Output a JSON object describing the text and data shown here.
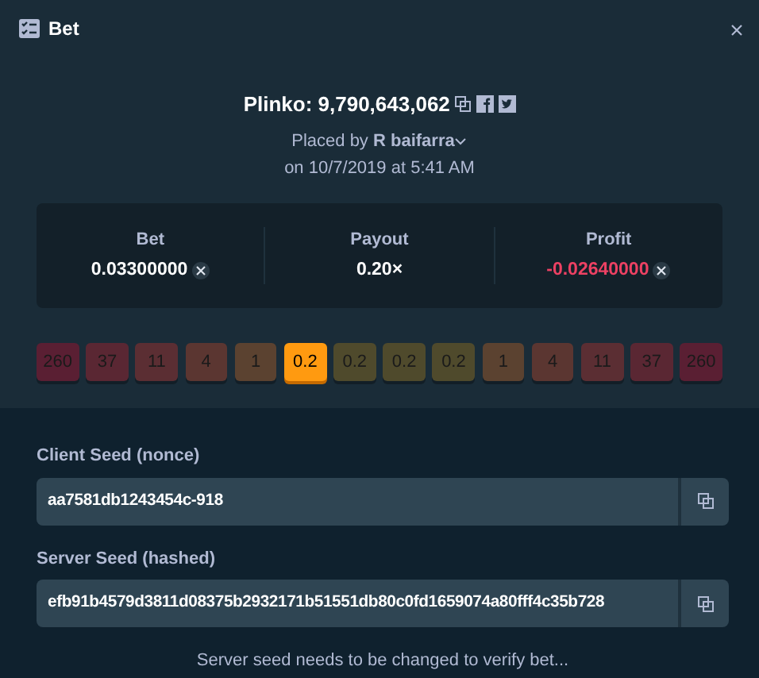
{
  "window": {
    "title": "Bet"
  },
  "bet_title": "Plinko: 9,790,643,062",
  "placed_by": {
    "prefix": "Placed by",
    "user": "R baifarra",
    "date": "on 10/7/2019 at 5:41 AM"
  },
  "stats": [
    {
      "label": "Bet",
      "value": "0.03300000",
      "kind": "currency",
      "negative": false
    },
    {
      "label": "Payout",
      "value": "0.20×",
      "kind": "plain",
      "negative": false
    },
    {
      "label": "Profit",
      "value": "-0.02640000",
      "kind": "currency",
      "negative": true
    }
  ],
  "multipliers": [
    {
      "value": "260",
      "color": "#5a1f33",
      "selected": false
    },
    {
      "value": "37",
      "color": "#5a2733",
      "selected": false
    },
    {
      "value": "11",
      "color": "#5b2e33",
      "selected": false
    },
    {
      "value": "4",
      "color": "#5b3631",
      "selected": false
    },
    {
      "value": "1",
      "color": "#5b4230",
      "selected": false
    },
    {
      "value": "0.2",
      "color": "#ff9a10",
      "selected": true
    },
    {
      "value": "0.2",
      "color": "#4f4a2c",
      "selected": false
    },
    {
      "value": "0.2",
      "color": "#4f4a2c",
      "selected": false
    },
    {
      "value": "0.2",
      "color": "#4f4a2c",
      "selected": false
    },
    {
      "value": "1",
      "color": "#5b4230",
      "selected": false
    },
    {
      "value": "4",
      "color": "#5b3631",
      "selected": false
    },
    {
      "value": "11",
      "color": "#5b2e33",
      "selected": false
    },
    {
      "value": "37",
      "color": "#5a2733",
      "selected": false
    },
    {
      "value": "260",
      "color": "#5a1f33",
      "selected": false
    }
  ],
  "seeds": [
    {
      "label": "Client Seed (nonce)",
      "value": "aa7581db1243454c-918"
    },
    {
      "label": "Server Seed (hashed)",
      "value": "efb91b4579d3811d08375b2932171b51551db80c0fd1659074a80fff4c35b728"
    }
  ],
  "note": "Server seed needs to be changed to verify bet..."
}
